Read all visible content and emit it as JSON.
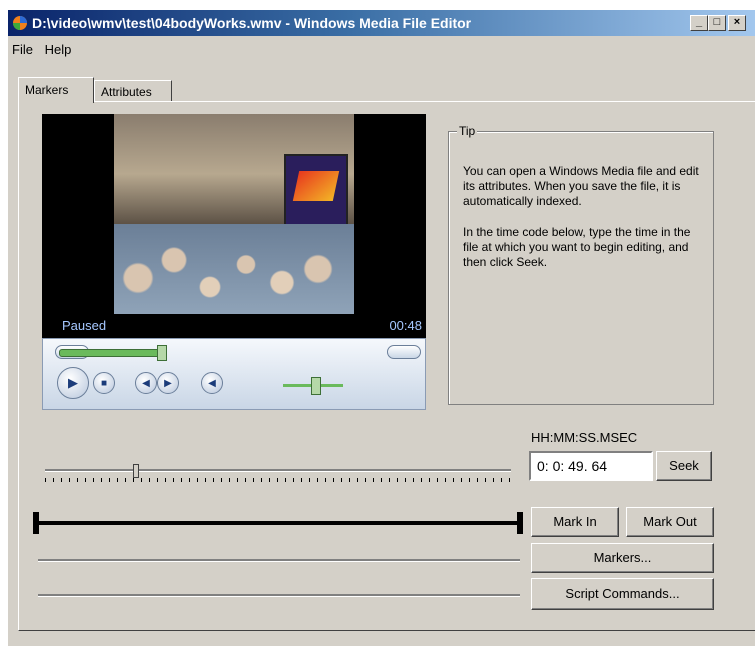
{
  "window": {
    "title": "D:\\video\\wmv\\test\\04bodyWorks.wmv - Windows Media File Editor",
    "minimize": "_",
    "maximize": "□",
    "close": "×"
  },
  "menu": [
    "File",
    "Help"
  ],
  "tabs": [
    {
      "label": "Markers",
      "active": true
    },
    {
      "label": "Attributes",
      "active": false
    }
  ],
  "player": {
    "status": "Paused",
    "time": "00:48",
    "seek_position": 0.3,
    "volume": 0.5,
    "icons": [
      "play-icon",
      "stop-icon",
      "previous-icon",
      "next-icon",
      "mute-icon"
    ]
  },
  "tip": {
    "legend": "Tip",
    "paragraph1": "You can open a Windows Media file and edit its attributes. When you save the file, it is automatically indexed.",
    "paragraph2": "In the time code below, type the time in the file at which you want to begin editing, and then click Seek."
  },
  "timecode": {
    "label": "HH:MM:SS.MSEC",
    "value": "0:  0: 49.  64"
  },
  "buttons": {
    "seek": "Seek",
    "mark_in": "Mark In",
    "mark_out": "Mark Out",
    "markers": "Markers...",
    "script_commands": "Script Commands..."
  },
  "colors": {
    "title_start": "#0a246a",
    "title_end": "#a6caf0",
    "face": "#d4d0c8",
    "player_text": "#a6c8ff",
    "seek_fill": "#6aba5c"
  }
}
